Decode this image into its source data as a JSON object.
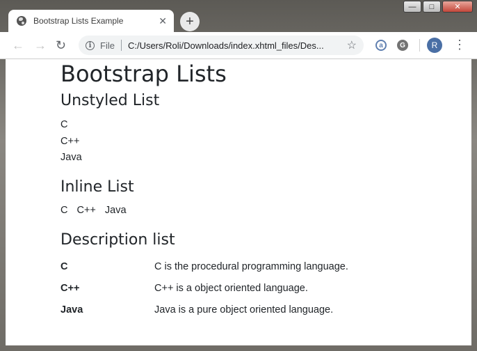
{
  "browser": {
    "tab_title": "Bootstrap Lists Example",
    "url_scheme": "File",
    "url": "C:/Users/Roli/Downloads/index.xhtml_files/Des...",
    "avatar_letter": "R"
  },
  "page": {
    "title": "Bootstrap Lists",
    "unstyled": {
      "heading": "Unstyled List",
      "items": [
        "C",
        "C++",
        "Java"
      ]
    },
    "inline": {
      "heading": "Inline List",
      "items": [
        "C",
        "C++",
        "Java"
      ]
    },
    "description": {
      "heading": "Description list",
      "items": [
        {
          "term": "C",
          "desc": "C is the procedural programming language."
        },
        {
          "term": "C++",
          "desc": "C++ is a object oriented language."
        },
        {
          "term": "Java",
          "desc": "Java is a pure object oriented language."
        }
      ]
    }
  }
}
